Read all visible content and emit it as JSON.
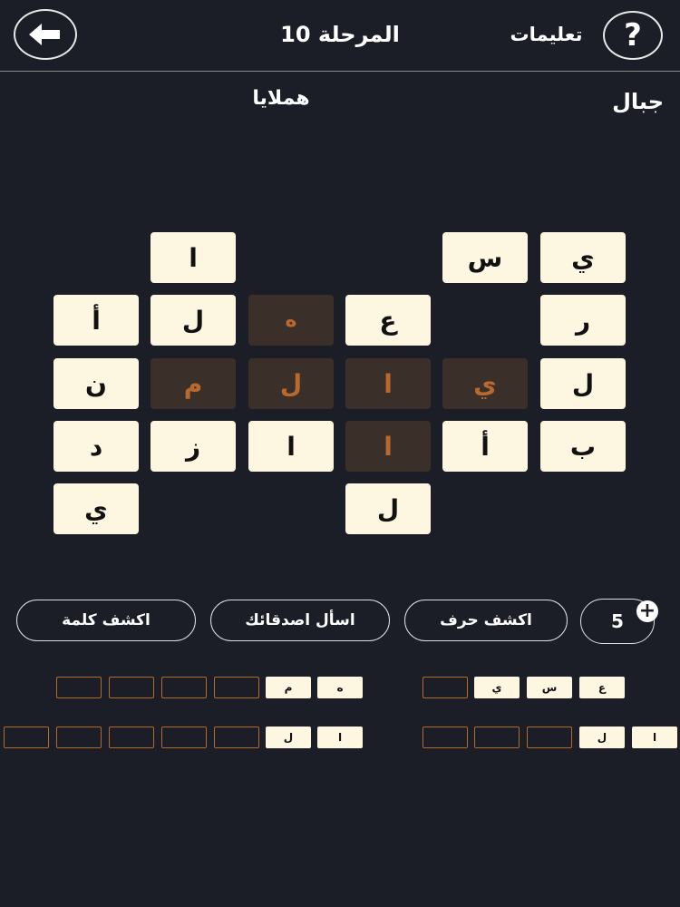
{
  "header": {
    "title": "المرحلة 10",
    "instructions": "تعليمات",
    "help_symbol": "?",
    "back_icon": "arrow-left-icon"
  },
  "puzzle": {
    "category": "جبال",
    "current_word": "هملايا"
  },
  "grid": {
    "r1c1": "ي",
    "r1c2": "س",
    "r1c6": "ا",
    "r2c1": "ر",
    "r2c3": "ع",
    "r2c4": "ه",
    "r2c5": "ل",
    "r2c6": "أ",
    "r3c1": "ل",
    "r3c2": "ي",
    "r3c3": "ا",
    "r3c4": "ل",
    "r3c5": "م",
    "r3c6": "ن",
    "r4c1": "ب",
    "r4c2": "أ",
    "r4c3": "ا",
    "r4c4": "ا",
    "r4c5": "ز",
    "r4c6": "د",
    "r5c3": "ل",
    "r5c6": "ي"
  },
  "actions": {
    "coins": "5",
    "reveal_letter": "اكشف حرف",
    "ask_friends": "اسأل اصدقائك",
    "reveal_word": "اكشف كلمة"
  },
  "slots": {
    "w1_1": "ع",
    "w1_2": "س",
    "w1_3": "ي",
    "w2_1": "ه",
    "w2_2": "م",
    "w3_1": "ا",
    "w3_2": "ل",
    "w4_1": "ا",
    "w4_2": "ل"
  },
  "colors": {
    "background": "#1c1e27",
    "tile": "#fdf6e1",
    "found_tile": "#3b3029",
    "found_text": "#b8692d"
  }
}
